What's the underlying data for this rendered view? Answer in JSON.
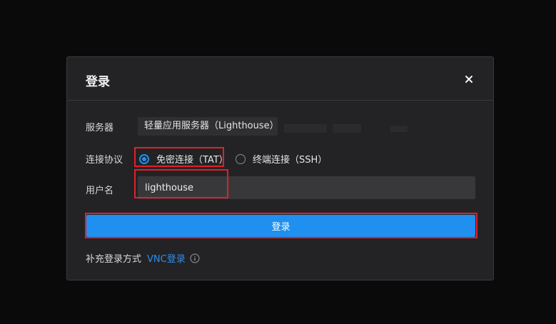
{
  "dialog": {
    "title": "登录",
    "close_icon": "close-icon"
  },
  "server": {
    "label": "服务器",
    "value": "轻量应用服务器（Lighthouse）"
  },
  "protocol": {
    "label": "连接协议",
    "options": [
      {
        "label": "免密连接（TAT）",
        "checked": true
      },
      {
        "label": "终端连接（SSH）",
        "checked": false
      }
    ]
  },
  "username": {
    "label": "用户名",
    "value": "lighthouse"
  },
  "login_button": {
    "label": "登录"
  },
  "footer": {
    "text": "补充登录方式",
    "link": "VNC登录",
    "info_icon": "info-icon"
  },
  "colors": {
    "accent": "#1f8ff0",
    "highlight": "#e0202a",
    "dialog_bg": "#232325"
  }
}
